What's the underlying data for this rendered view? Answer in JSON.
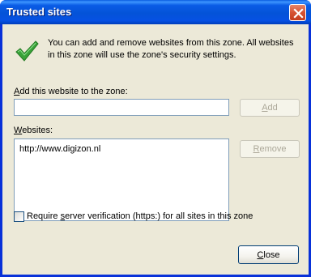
{
  "window": {
    "title": "Trusted sites"
  },
  "intro": {
    "text": "You can add and remove websites from this zone. All websites in this zone will use the zone's security settings."
  },
  "add_section": {
    "label_pre": "",
    "label_mnemonic": "A",
    "label_post": "dd this website to the zone:",
    "input_value": "",
    "add_button": {
      "pre": "",
      "mnemonic": "A",
      "post": "dd"
    }
  },
  "websites_section": {
    "label_pre": "",
    "label_mnemonic": "W",
    "label_post": "ebsites:",
    "items": [
      "http://www.digizon.nl"
    ],
    "remove_button": {
      "pre": "",
      "mnemonic": "R",
      "post": "emove"
    }
  },
  "verification": {
    "checked": false,
    "label_pre": "Require ",
    "label_mnemonic": "s",
    "label_post": "erver verification (https:) for all sites in this zone"
  },
  "close_button": {
    "pre": "",
    "mnemonic": "C",
    "post": "lose"
  },
  "colors": {
    "titlebar": "#0453d8",
    "dialog_bg": "#ece9d8",
    "close_btn": "#d65232",
    "checkmark": "#3aa33a"
  },
  "icons": {
    "close": "close-icon",
    "info": "checkmark-icon"
  }
}
